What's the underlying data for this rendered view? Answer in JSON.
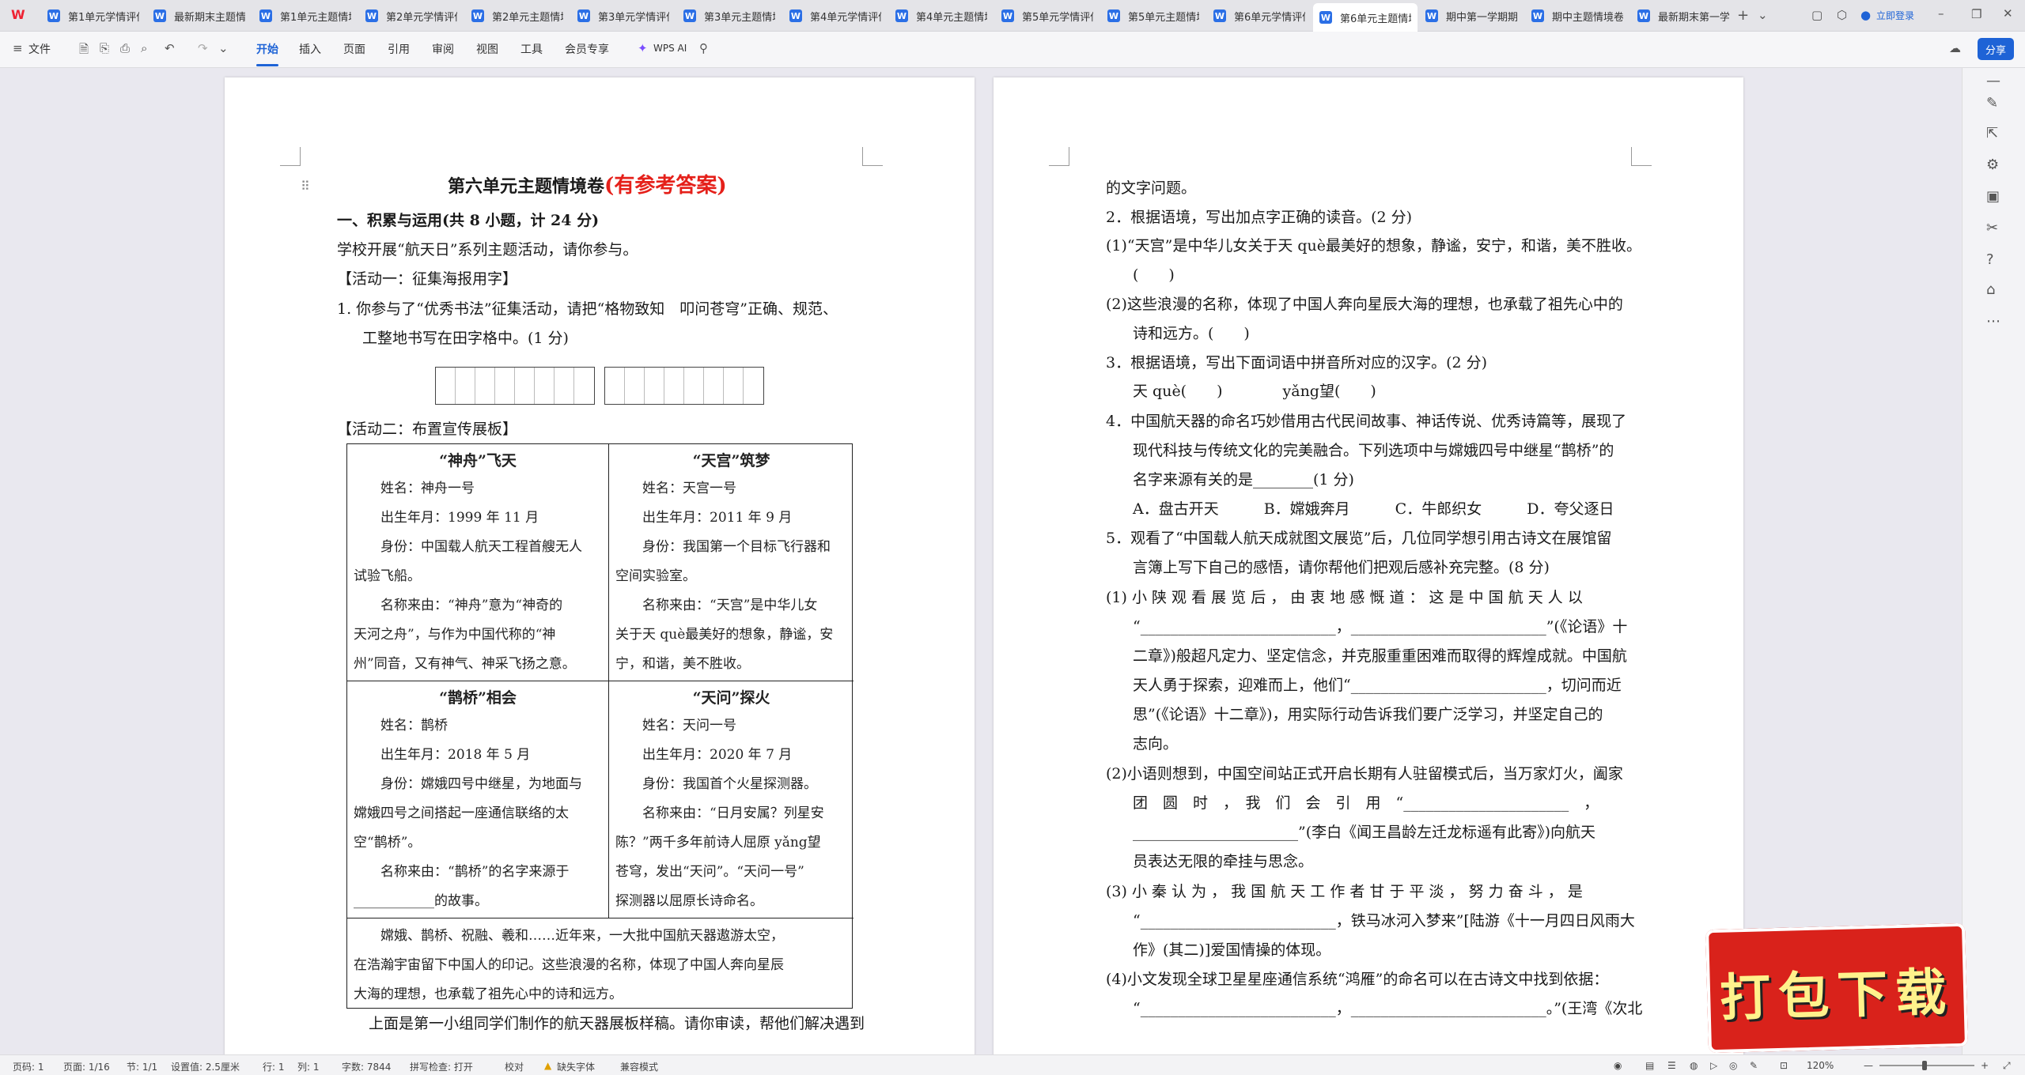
{
  "tabs": [
    "第1单元学情评估",
    "最新期末主题情境",
    "第1单元主题情境",
    "第2单元学情评估",
    "第2单元主题情境",
    "第3单元学情评估",
    "第3单元主题情境",
    "第4单元学情评估",
    "第4单元主题情境",
    "第5单元学情评估",
    "第5单元主题情境",
    "第6单元学情评估",
    "第6单元主题情境卷",
    "期中第一学期期中",
    "期中主题情境卷",
    "最新期末第一学期"
  ],
  "tab_icon": "W",
  "window": {
    "login": "立即登录"
  },
  "toolbar": {
    "file": "文件",
    "tabs": [
      "开始",
      "插入",
      "页面",
      "引用",
      "审阅",
      "视图",
      "工具",
      "会员专享"
    ],
    "ai": "WPS AI",
    "share": "分享"
  },
  "page1": {
    "title": "第六单元主题情境卷",
    "title_red": "(有参考答案)",
    "lines": [
      "一、积累与运用(共 8 小题，计 24 分)",
      "学校开展“航天日”系列主题活动，请你参与。",
      "【活动一：征集海报用字】",
      "1. 你参与了“优秀书法”征集活动，请把“格物致知　叩问苍穹”正确、规范、",
      "工整地书写在田字格中。(1 分)",
      "【活动二：布置宣传展板】"
    ],
    "cells": [
      {
        "title": "“神舟”飞天",
        "lines": [
          "姓名：神舟一号",
          "出生年月：1999 年 11 月",
          "身份：中国载人航天工程首艘无人",
          "试验飞船。",
          "名称来由：“神舟”意为“神奇的",
          "天河之舟”，与作为中国代称的“神",
          "州”同音，又有神气、神采飞扬之意。"
        ]
      },
      {
        "title": "“天宫”筑梦",
        "lines": [
          "姓名：天宫一号",
          "出生年月：2011 年 9 月",
          "身份：我国第一个目标飞行器和",
          "空间实验室。",
          "名称来由：“天宫”是中华儿女",
          "关于天 què最美好的想象，静谧，安",
          "宁，和谐，美不胜收。"
        ]
      },
      {
        "title": "“鹊桥”相会",
        "lines": [
          "姓名：鹊桥",
          "出生年月：2018 年 5 月",
          "身份：嫦娥四号中继星，为地面与",
          "嫦娥四号之间搭起一座通信联络的太",
          "空“鹊桥”。",
          "名称来由：“鹊桥”的名字来源于",
          "____________的故事。"
        ]
      },
      {
        "title": "“天问”探火",
        "lines": [
          "姓名：天问一号",
          "出生年月：2020 年 7 月",
          "身份：我国首个火星探测器。",
          "名称来由：“日月安属？列星安",
          "陈？”两千多年前诗人屈原 yǎng望",
          "苍穹，发出“天问”。“天问一号”",
          "探测器以屈原长诗命名。"
        ]
      }
    ],
    "bottom": [
      "嫦娥、鹊桥、祝融、羲和……近年来，一大批中国航天器遨游太空，",
      "在浩瀚宇宙留下中国人的印记。这些浪漫的名称，体现了中国人奔向星辰",
      "大海的理想，也承载了祖先心中的诗和远方。"
    ],
    "after": "上面是第一小组同学们制作的航天器展板样稿。请你审读，帮他们解决遇到"
  },
  "page2": {
    "lines": [
      "的文字问题。",
      "2．根据语境，写出加点字正确的读音。(2 分)",
      "(1)“天宫”是中华儿女关于天 què最美好的想象，静谧，安宁，和谐，美不胜收。",
      "(　　)",
      "(2)这些浪漫的名称，体现了中国人奔向星辰大海的理想，也承载了祖先心中的",
      "诗和远方。(　　)",
      "3．根据语境，写出下面词语中拼音所对应的汉字。(2 分)",
      "天 què(　　)　　　　yǎng望(　　)",
      "4．中国航天器的命名巧妙借用古代民间故事、神话传说、优秀诗篇等，展现了",
      "现代科技与传统文化的完美融合。下列选项中与嫦娥四号中继星“鹊桥”的",
      "名字来源有关的是________(1 分)",
      "A．盘古开天　　　B．嫦娥奔月　　　C．牛郎织女　　　D．夸父逐日",
      "5．观看了“中国载人航天成就图文展览”后，几位同学想引用古诗文在展馆留",
      "言簿上写下自己的感悟，请你帮他们把观后感补充完整。(8 分)",
      "(1) 小 陕 观 看 展 览 后 ， 由 衷 地 感 慨 道 ： 这 是 中 国 航 天 人 以",
      "“__________________________，__________________________”(《论语》十",
      "二章》)般超凡定力、坚定信念，并克服重重困难而取得的辉煌成就。中国航",
      "天人勇于探索，迎难而上，他们“__________________________，切问而近",
      "思”(《论语》十二章》)，用实际行动告诉我们要广泛学习，并坚定自己的",
      "志向。",
      "(2)小语则想到，中国空间站正式开启长期有人驻留模式后，当万家灯火，阖家",
      "团　圆　时　，　我　们　会　引　用　“______________________　，",
      "______________________”(李白《闻王昌龄左迁龙标遥有此寄》)向航天",
      "员表达无限的牵挂与思念。",
      "(3) 小 秦 认 为 ， 我 国 航 天 工 作 者 甘 于 平 淡 ， 努 力 奋 斗 ， 是",
      "“__________________________，铁马冰河入梦来”[陆游《十一月四日风雨大",
      "作》(其二)]爱国情操的体现。",
      "(4)小文发现全球卫星星座通信系统“鸿雁”的命名可以在古诗文中找到依据：",
      "“__________________________，__________________________。”(王湾《次北"
    ]
  },
  "status": {
    "page": "页码: 1",
    "pages": "页面: 1/16",
    "section": "节: 1/1",
    "setting": "设置值: 2.5厘米",
    "row": "行: 1",
    "col": "列: 1",
    "words": "字数: 7844",
    "spell": "拼写检查: 打开",
    "proof": "校对",
    "font": "缺失字体",
    "compat": "兼容模式",
    "zoom": "120%"
  },
  "promo": "打包下载",
  "colors": {
    "accent": "#1e63d6",
    "red": "#e5201a",
    "promo": "#d9221b"
  }
}
